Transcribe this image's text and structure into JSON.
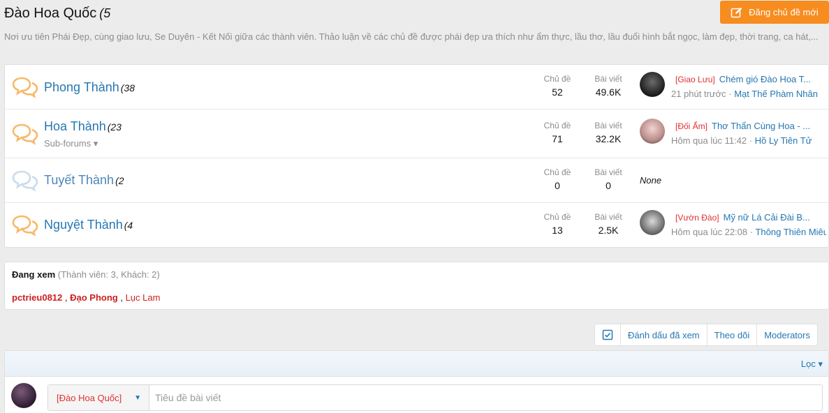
{
  "header": {
    "title": "Đào Hoa Quốc",
    "title_count": "(5",
    "description": "Nơi ưu tiên Phái Đẹp, cùng giao lưu, Se Duyên - Kết Nối giữa các thành viên. Thảo luận về các chủ đề được phái đẹp ưa thích như ẩm thực, lầu thơ, lầu đuổi hình bắt ngọc, làm đẹp, thời trang, ca hát,...",
    "new_thread_label": "Đăng chủ đề mới"
  },
  "colors": {
    "accent": "#f78c1f",
    "link": "#2577b1",
    "prefix_red": "#e03030"
  },
  "forums": [
    {
      "title": "Phong Thành",
      "count": "(38",
      "stats": {
        "threads_label": "Chủ đề",
        "threads": "52",
        "posts_label": "Bài viết",
        "posts": "49.6K"
      },
      "last": {
        "prefix": "[Giao Lưu]",
        "title": "Chém gió Đào Hoa T...",
        "time": "21 phút trước",
        "sep": " · ",
        "user": "Mạt Thế Phàm Nhân"
      }
    },
    {
      "title": "Hoa Thành",
      "count": "(23",
      "subforums": "Sub-forums ▾",
      "stats": {
        "threads_label": "Chủ đề",
        "threads": "71",
        "posts_label": "Bài viết",
        "posts": "32.2K"
      },
      "last": {
        "prefix": "[Đối Ẩm]",
        "title": "Thơ Thẩn Cùng Hoa - ...",
        "time": "Hôm qua lúc 11:42",
        "sep": " · ",
        "user": "Hồ Ly Tiên Tử"
      }
    },
    {
      "title": "Tuyết Thành",
      "count": "(2",
      "stats": {
        "threads_label": "Chủ đề",
        "threads": "0",
        "posts_label": "Bài viết",
        "posts": "0"
      },
      "last_none": "None"
    },
    {
      "title": "Nguyệt Thành",
      "count": "(4",
      "stats": {
        "threads_label": "Chủ đề",
        "threads": "13",
        "posts_label": "Bài viết",
        "posts": "2.5K"
      },
      "last": {
        "prefix": "[Vườn Đào]",
        "title": "Mỹ nữ Lá Cải Đài B...",
        "time": "Hôm qua lúc 22:08",
        "sep": " · ",
        "user": "Thông Thiên Miêu"
      }
    }
  ],
  "viewing": {
    "label": "Đang xem",
    "detail": "(Thành viên: 3, Khách: 2)",
    "users": [
      "pctrieu0812",
      "Đạo Phong",
      "Lục Lam"
    ],
    "sep": " , "
  },
  "actions": {
    "mark_read": "Đánh dấu đã xem",
    "watch": "Theo dõi",
    "moderators": "Moderators"
  },
  "filter": {
    "label": "Lọc ▾"
  },
  "quick_thread": {
    "prefix": "[Đào Hoa Quốc]",
    "caret": "▼",
    "placeholder": "Tiêu đề bài viết"
  },
  "icons": {
    "new_thread": "edit-icon",
    "forum": "chat-bubbles-icon",
    "check": "checkbox-icon"
  }
}
